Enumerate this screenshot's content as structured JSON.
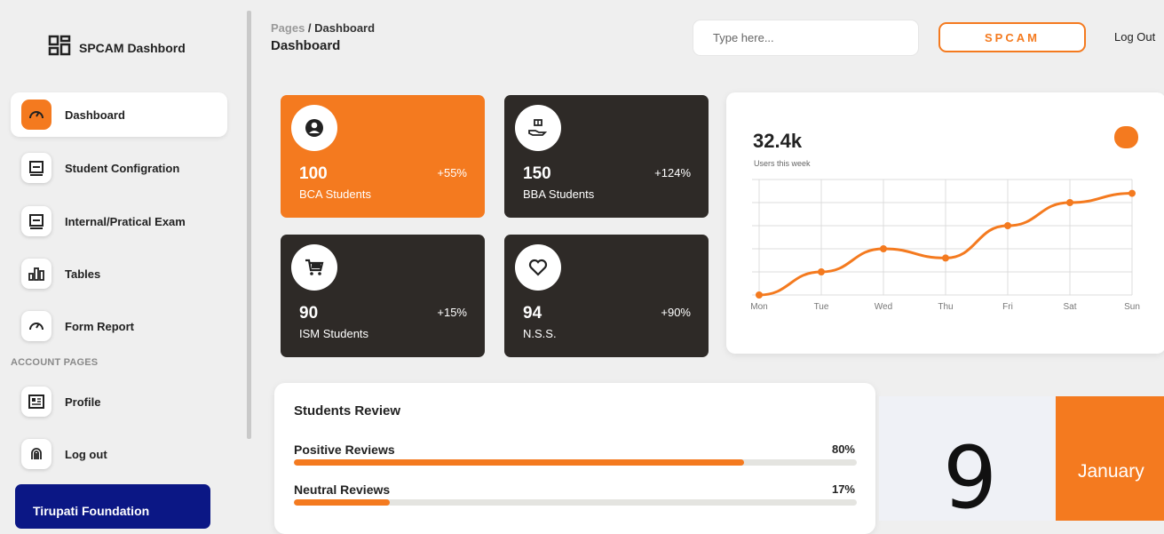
{
  "sidebar": {
    "brand": {
      "icon": "dashboard-grid-icon",
      "title": "SPCAM Dashbord"
    },
    "items": [
      {
        "label": "Dashboard",
        "icon": "speedometer-icon",
        "active": true
      },
      {
        "label": "Student Configration",
        "icon": "monitor-icon"
      },
      {
        "label": "Internal/Pratical Exam",
        "icon": "monitor-icon"
      },
      {
        "label": "Tables",
        "icon": "bar-chart-icon"
      },
      {
        "label": "Form Report",
        "icon": "speedometer-icon"
      }
    ],
    "account_heading": "ACCOUNT PAGES",
    "account_items": [
      {
        "label": "Profile",
        "icon": "id-card-icon"
      },
      {
        "label": "Log out",
        "icon": "fingerprint-icon"
      }
    ],
    "foundation": "Tirupati Foundation"
  },
  "header": {
    "breadcrumb_root": "Pages",
    "breadcrumb_sep": " / ",
    "breadcrumb_current": "Dashboard",
    "page_title": "Dashboard",
    "search_placeholder": "Type here...",
    "brand_button": "SPCAM",
    "logout": "Log Out"
  },
  "stats": [
    {
      "value": "100",
      "change": "+55%",
      "label": "BCA Students",
      "icon": "user-circle-icon",
      "accent": "#f47a1f"
    },
    {
      "value": "150",
      "change": "+124%",
      "label": "BBA Students",
      "icon": "hand-gift-icon",
      "accent": "#2e2a27"
    },
    {
      "value": "90",
      "change": "+15%",
      "label": "ISM Students",
      "icon": "cart-icon",
      "accent": "#2e2a27"
    },
    {
      "value": "94",
      "change": "+90%",
      "label": "N.S.S.",
      "icon": "heart-icon",
      "accent": "#2e2a27"
    }
  ],
  "users_card": {
    "value": "32.4k",
    "subtitle": "Users this week",
    "accent": "#f47a1f"
  },
  "chart_data": {
    "type": "line",
    "categories": [
      "Mon",
      "Tue",
      "Wed",
      "Thu",
      "Fri",
      "Sat",
      "Sun"
    ],
    "series": [
      {
        "values": [
          0,
          10,
          20,
          16,
          30,
          40,
          44
        ]
      }
    ],
    "ylim": [
      0,
      50
    ],
    "grid": true,
    "color": "#f47a1f"
  },
  "reviews": {
    "title": "Students Review",
    "items": [
      {
        "label": "Positive Reviews",
        "percent": "80%",
        "fill": 0.8
      },
      {
        "label": "Neutral Reviews",
        "percent": "17%",
        "fill": 0.17
      }
    ]
  },
  "calendar": {
    "day": "9",
    "month": "January"
  }
}
